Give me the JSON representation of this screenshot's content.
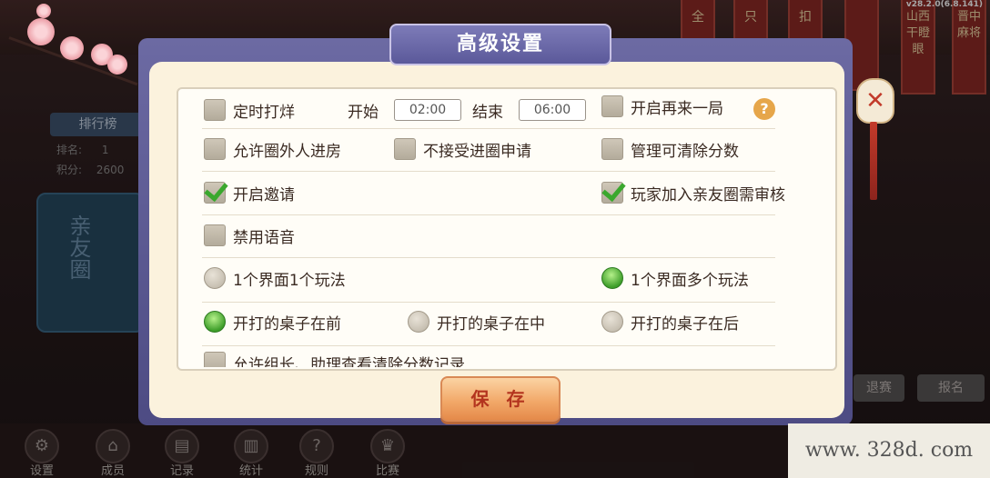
{
  "version": "v28.2.0(6.8.141)",
  "background": {
    "rank_tab": "排行榜",
    "rank_label": "排名:",
    "rank_value": "1",
    "score_label": "积分:",
    "score_value": "2600",
    "side_tab": "亲友圈",
    "banners": [
      "全",
      "只",
      "扣",
      "",
      "山西干瞪眼",
      "晋中麻将"
    ],
    "right_buttons": [
      "退赛",
      "报名"
    ],
    "bottom_nav": [
      {
        "label": "设置",
        "icon": "gear-icon"
      },
      {
        "label": "成员",
        "icon": "pavilion-icon"
      },
      {
        "label": "记录",
        "icon": "record-icon"
      },
      {
        "label": "统计",
        "icon": "stats-icon"
      },
      {
        "label": "规则",
        "icon": "help-icon"
      },
      {
        "label": "比赛",
        "icon": "trophy-icon"
      }
    ]
  },
  "dialog": {
    "title": "高级设置",
    "options": {
      "timed_close": {
        "label": "定时打烊",
        "checked": false
      },
      "start_label": "开始",
      "start_time": "02:00",
      "end_label": "结束",
      "end_time": "06:00",
      "play_again": {
        "label": "开启再来一局",
        "checked": false
      },
      "allow_outsiders": {
        "label": "允许圈外人进房",
        "checked": false
      },
      "reject_join": {
        "label": "不接受进圈申请",
        "checked": false
      },
      "admin_clear_score": {
        "label": "管理可清除分数",
        "checked": false
      },
      "enable_invite": {
        "label": "开启邀请",
        "checked": true
      },
      "join_review": {
        "label": "玩家加入亲友圈需审核",
        "checked": true
      },
      "disable_voice": {
        "label": "禁用语音",
        "checked": false
      },
      "one_mode": {
        "label": "1个界面1个玩法",
        "selected": false
      },
      "multi_mode": {
        "label": "1个界面多个玩法",
        "selected": true
      },
      "table_front": {
        "label": "开打的桌子在前",
        "selected": true
      },
      "table_middle": {
        "label": "开打的桌子在中",
        "selected": false
      },
      "table_back": {
        "label": "开打的桌子在后",
        "selected": false
      },
      "allow_view_clear_record": {
        "label": "允许组长、助理查看清除分数记录",
        "checked": false
      }
    },
    "help_icon": "?",
    "save_label": "保 存",
    "close_icon": "✕"
  },
  "watermark": "www. 328d. com"
}
